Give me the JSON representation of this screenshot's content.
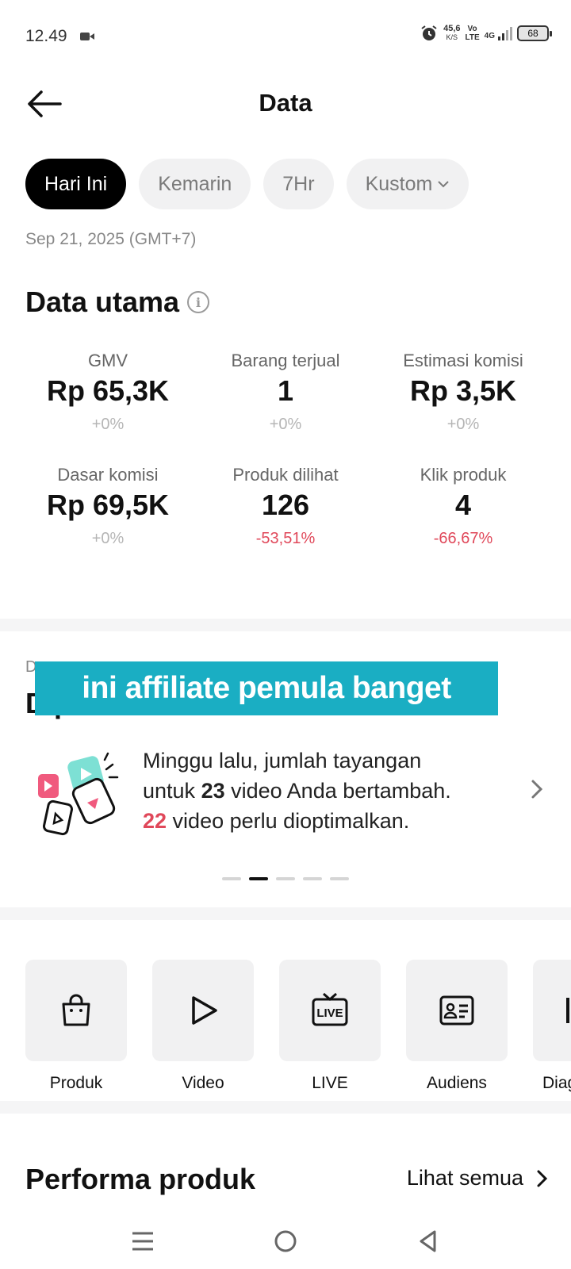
{
  "status_bar": {
    "time": "12.49",
    "net_speed_value": "45,6",
    "net_speed_unit": "K/S",
    "volte_top": "Vo",
    "volte_bottom": "LTE",
    "network": "4G",
    "battery": "68"
  },
  "header": {
    "title": "Data"
  },
  "date_filters": [
    {
      "label": "Hari Ini",
      "active": true
    },
    {
      "label": "Kemarin",
      "active": false
    },
    {
      "label": "7Hr",
      "active": false
    },
    {
      "label": "Kustom",
      "active": false
    }
  ],
  "date_label": "Sep 21, 2025 (GMT+7)",
  "key_data": {
    "title": "Data utama",
    "metrics": [
      {
        "label": "GMV",
        "value": "Rp 65,3K",
        "change": "+0%"
      },
      {
        "label": "Barang terjual",
        "value": "1",
        "change": "+0%"
      },
      {
        "label": "Estimasi komisi",
        "value": "Rp 3,5K",
        "change": "+0%"
      },
      {
        "label": "Dasar komisi",
        "value": "Rp 69,5K",
        "change": "+0%"
      },
      {
        "label": "Produk dilihat",
        "value": "126",
        "change": "-53,51%"
      },
      {
        "label": "Klik produk",
        "value": "4",
        "change": "-66,67%"
      }
    ]
  },
  "diagnosis": {
    "subtitle": "D",
    "title": "D                                                   p",
    "overlay_caption": "ini affiliate pemula banget",
    "tip": {
      "line1": "Minggu lalu, jumlah tayangan",
      "line2_pre": "untuk ",
      "line2_num": "23",
      "line2_post": " video Anda bertambah.",
      "line3_num": "22",
      "line3_post": " video perlu dioptimalkan."
    },
    "pager_count": 5,
    "pager_active": 1
  },
  "quick_links": [
    {
      "label": "Produk",
      "icon": "shopping-bag-icon"
    },
    {
      "label": "Video",
      "icon": "play-icon"
    },
    {
      "label": "LIVE",
      "icon": "live-tv-icon"
    },
    {
      "label": "Audiens",
      "icon": "id-card-icon"
    },
    {
      "label": "Diag",
      "icon": "diagnosis-icon"
    }
  ],
  "product_performance": {
    "title": "Performa produk",
    "see_all": "Lihat semua"
  },
  "colors": {
    "accent_negative": "#e0485a",
    "overlay": "#1aaec3",
    "chip_active": "#000000"
  }
}
